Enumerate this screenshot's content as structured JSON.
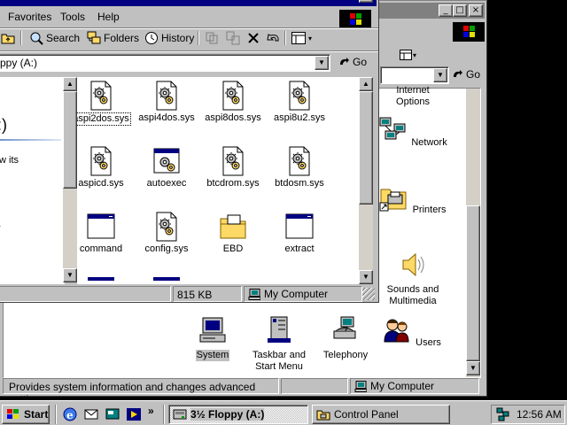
{
  "floppy_window": {
    "menu": [
      "Favorites",
      "Tools",
      "Help"
    ],
    "toolbar": {
      "search": "Search",
      "folders": "Folders",
      "history": "History"
    },
    "address": "ppy (A:)",
    "go": "Go",
    "left_pane": {
      "heading": ":)",
      "line1": "w its",
      "line2": "}"
    },
    "files": [
      {
        "name": "aspi2dos.sys",
        "kind": "sys"
      },
      {
        "name": "aspi4dos.sys",
        "kind": "sys"
      },
      {
        "name": "aspi8dos.sys",
        "kind": "sys"
      },
      {
        "name": "aspi8u2.sys",
        "kind": "sys"
      },
      {
        "name": "aspicd.sys",
        "kind": "sys"
      },
      {
        "name": "autoexec",
        "kind": "bat"
      },
      {
        "name": "btcdrom.sys",
        "kind": "sys"
      },
      {
        "name": "btdosm.sys",
        "kind": "sys"
      },
      {
        "name": "command",
        "kind": "app"
      },
      {
        "name": "config.sys",
        "kind": "sys"
      },
      {
        "name": "EBD",
        "kind": "folder"
      },
      {
        "name": "extract",
        "kind": "app"
      }
    ],
    "status": {
      "size": "815 KB",
      "location": "My Computer"
    }
  },
  "control_panel": {
    "go": "Go",
    "items_right": [
      "Internet Options",
      "Network",
      "Printers",
      "Sounds and Multimedia"
    ],
    "items_bottom": [
      "System",
      "Taskbar and Start Menu",
      "Telephony",
      "Users"
    ],
    "status_text": "Provides system information and changes advanced settings.",
    "status_location": "My Computer"
  },
  "taskbar": {
    "start": "Start",
    "tasks": [
      "3½ Floppy (A:)",
      "Control Panel"
    ],
    "chevron": "»",
    "time": "12:56 AM"
  }
}
